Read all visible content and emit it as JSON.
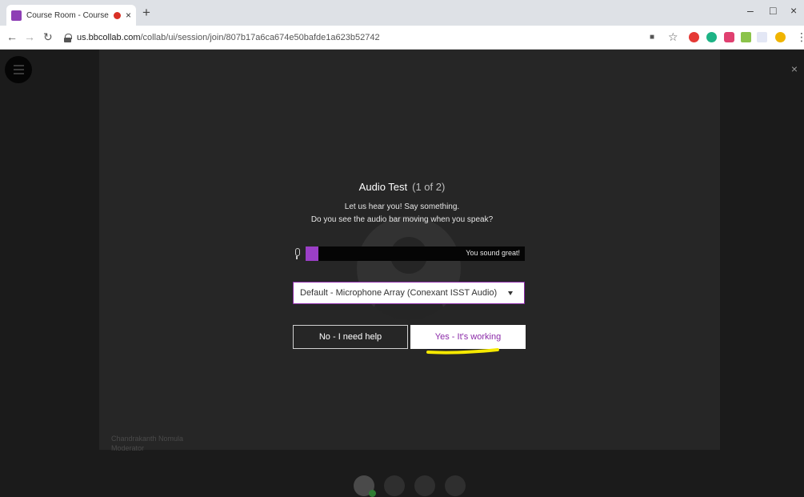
{
  "browser": {
    "tab_title": "Course Room - Course Room",
    "tab_close": "×",
    "new_tab": "+",
    "url_host": "us.bbcollab.com",
    "url_path": "/collab/ui/session/join/807b17a6ca674e50bafde1a623b52742",
    "window_buttons": [
      "–",
      "□",
      "×"
    ]
  },
  "session": {
    "close_label": "×",
    "participant_name": "Chandrakanth Nomula",
    "participant_role": "Moderator"
  },
  "dialog": {
    "title": "Audio Test",
    "step": "(1 of 2)",
    "line1": "Let us hear you! Say something.",
    "line2": "Do you see the audio bar moving when you speak?",
    "meter_status": "You sound great!",
    "meter_level_percent": 6,
    "device_selected": "Default - Microphone Array (Conexant ISST Audio)",
    "no_button": "No - I need help",
    "yes_button": "Yes - It's working"
  },
  "colors": {
    "accent": "#8b2aa8",
    "meter": "#9b3fc7",
    "highlight": "#f5e800",
    "recording": "#d93025"
  }
}
